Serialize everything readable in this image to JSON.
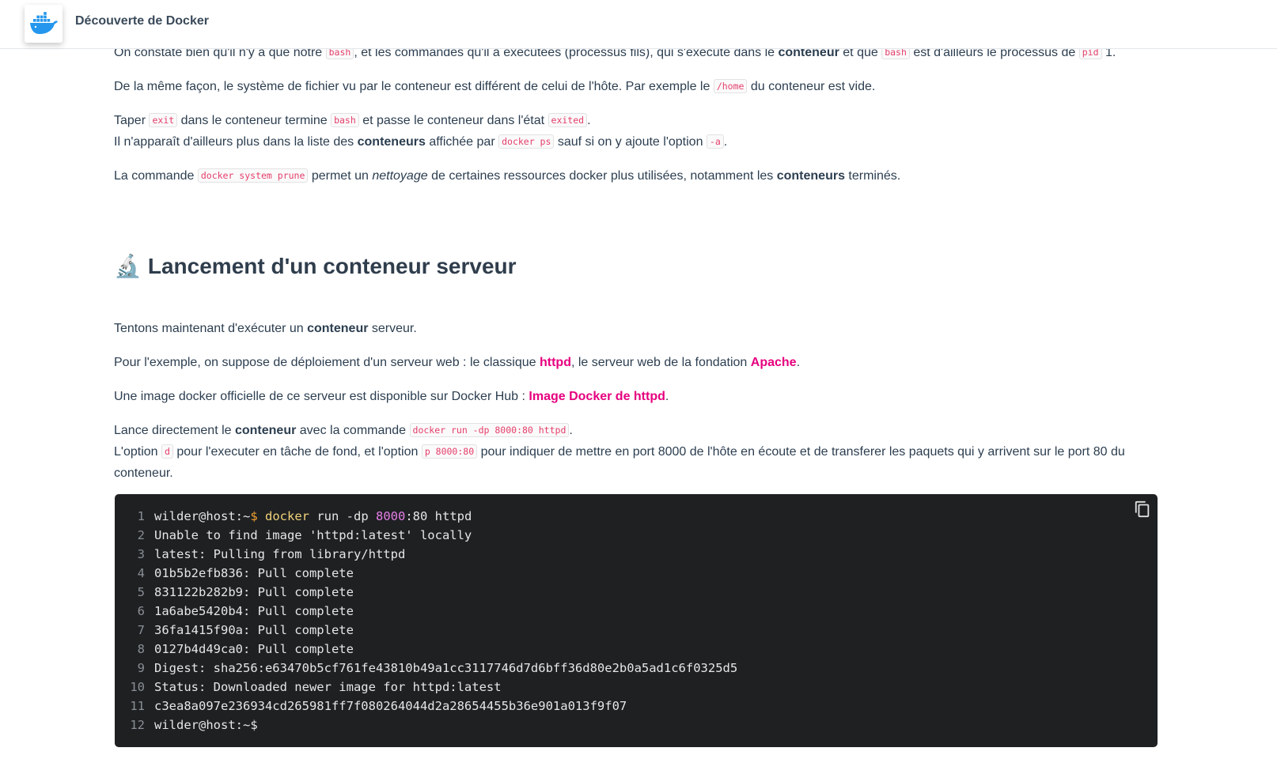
{
  "header": {
    "title": "Découverte de Docker",
    "logo_icon": "docker-whale-icon"
  },
  "intro": {
    "p1": {
      "t1": "On constate bien qu'il n'y a que notre ",
      "c1": "bash",
      "t2": ", et les commandes qu'il a exécutées (processus fils), qui s'exécute dans le ",
      "b1": "conteneur",
      "t3": " et que ",
      "c2": "bash",
      "t4": " est d'ailleurs le processus de ",
      "c3": "pid",
      "t5": " 1."
    },
    "p2": {
      "t1": "De la même façon, le système de fichier vu par le conteneur est différent de celui de l'hôte. Par exemple le ",
      "c1": "/home",
      "t2": " du conteneur est vide."
    },
    "p3": {
      "t1": "Taper ",
      "c1": "exit",
      "t2": " dans le conteneur termine ",
      "c2": "bash",
      "t3": " et passe le conteneur dans l'état ",
      "c3": "exited",
      "t4": ".",
      "t5": "Il n'apparaît d'ailleurs plus dans la liste des ",
      "b1": "conteneurs",
      "t6": " affichée par ",
      "c4": "docker ps",
      "t7": " sauf si on y ajoute l'option ",
      "c5": "-a",
      "t8": "."
    },
    "p4": {
      "t1": "La commande ",
      "c1": "docker system prune",
      "t2": " permet un ",
      "i1": "nettoyage",
      "t3": " de certaines ressources docker plus utilisées, notamment les ",
      "b1": "conteneurs",
      "t4": " terminés."
    }
  },
  "section": {
    "emoji": "🔬",
    "heading": "Lancement d'un conteneur serveur",
    "p1": {
      "t1": "Tentons maintenant d'exécuter un ",
      "b1": "conteneur",
      "t2": " serveur."
    },
    "p2": {
      "t1": "Pour l'exemple, on suppose de déploiement d'un serveur web : le classique ",
      "a1": "httpd",
      "t2": ", le serveur web de la fondation ",
      "a2": "Apache",
      "t3": "."
    },
    "p3": {
      "t1": "Une image docker officielle de ce serveur est disponible sur Docker Hub : ",
      "a1": "Image Docker de httpd",
      "t2": "."
    },
    "p4": {
      "t1": "Lance directement le ",
      "b1": "conteneur",
      "t2": " avec la commande ",
      "c1": "docker run -dp 8000:80 httpd",
      "t3": ".",
      "t4": "L'option ",
      "c2": "d",
      "t5": " pour l'executer en tâche de fond, et l'option ",
      "c3": "p 8000:80",
      "t6": " pour indiquer de mettre en port 8000 de l'hôte en écoute et de transferer les paquets qui y arrivent sur le port 80 du conteneur."
    }
  },
  "codeblock": {
    "copy_icon": "copy-icon",
    "line1": {
      "n": "1",
      "prompt": "wilder@host:~",
      "dollar": "$",
      "cmd": "docker",
      "mid": " run -dp ",
      "port": "8000",
      "rest": ":80 httpd"
    },
    "lines": [
      {
        "n": "2",
        "text": "Unable to find image 'httpd:latest' locally"
      },
      {
        "n": "3",
        "text": "latest: Pulling from library/httpd"
      },
      {
        "n": "4",
        "text": "01b5b2efb836: Pull complete"
      },
      {
        "n": "5",
        "text": "831122b282b9: Pull complete"
      },
      {
        "n": "6",
        "text": "1a6abe5420b4: Pull complete"
      },
      {
        "n": "7",
        "text": "36fa1415f90a: Pull complete"
      },
      {
        "n": "8",
        "text": "0127b4d49ca0: Pull complete"
      },
      {
        "n": "9",
        "text": "Digest: sha256:e63470b5cf761fe43810b49a1cc3117746d7d6bff36d80e2b0a5ad1c6f0325d5"
      },
      {
        "n": "10",
        "text": "Status: Downloaded newer image for httpd:latest"
      },
      {
        "n": "11",
        "text": "c3ea8a097e236934cd265981ff7f080264044d2a28654455b36e901a013f9f07"
      },
      {
        "n": "12",
        "text": "wilder@host:~$"
      }
    ]
  }
}
